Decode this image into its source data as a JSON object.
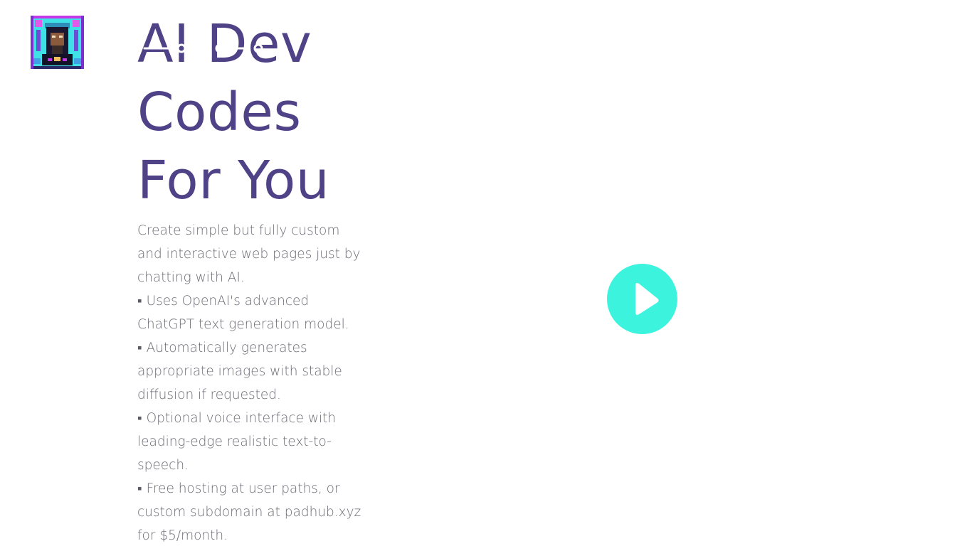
{
  "hero": {
    "title_lines": [
      "AI Dev",
      "Codes",
      "For You"
    ]
  },
  "description": {
    "intro": "Create simple but fully custom and interactive web pages just by chatting with AI.",
    "features": [
      "Uses OpenAI's advanced ChatGPT text generation model.",
      "Automatically generates appropriate images with stable diffusion if requested.",
      "Optional voice interface with leading-edge realistic text-to-speech.",
      "Free hosting at user paths, or custom subdomain at padhub.xyz for $5/month."
    ]
  },
  "icons": {
    "logo": "pixel-art-avatar-icon",
    "play": "play-icon"
  },
  "colors": {
    "title": "#4f4286",
    "body_text": "#6b6b74",
    "play_button": "#3cf3de"
  }
}
